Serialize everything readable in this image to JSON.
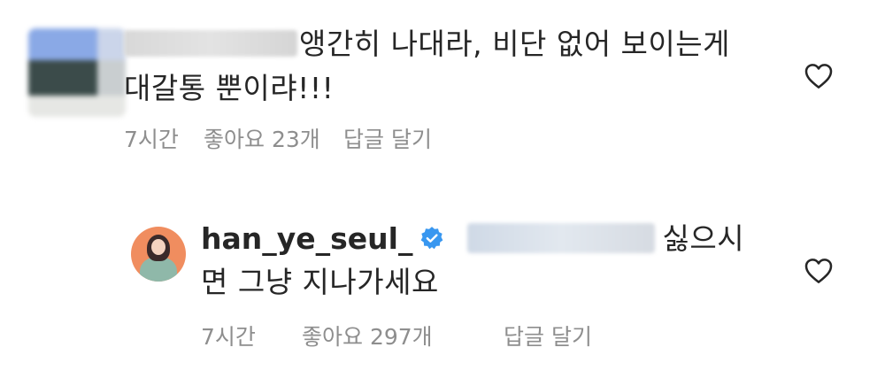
{
  "comments": [
    {
      "text_line1": "앵간히 나대라, 비단 없어 보이는게",
      "text_line2": "대갈통 뿐이랴!!!",
      "time": "7시간",
      "likes": "좋아요 23개",
      "reply_label": "답글 달기",
      "heart_icon": "heart-outline-icon"
    },
    {
      "username": "han_ye_seul_",
      "verified_icon": "verified-badge-icon",
      "verified_color": "#3897f0",
      "text_line1_suffix": "싫으시",
      "text_line2": "면 그냥 지나가세요",
      "time": "7시간",
      "likes": "좋아요 297개",
      "reply_label": "답글 달기",
      "heart_icon": "heart-outline-icon"
    }
  ]
}
